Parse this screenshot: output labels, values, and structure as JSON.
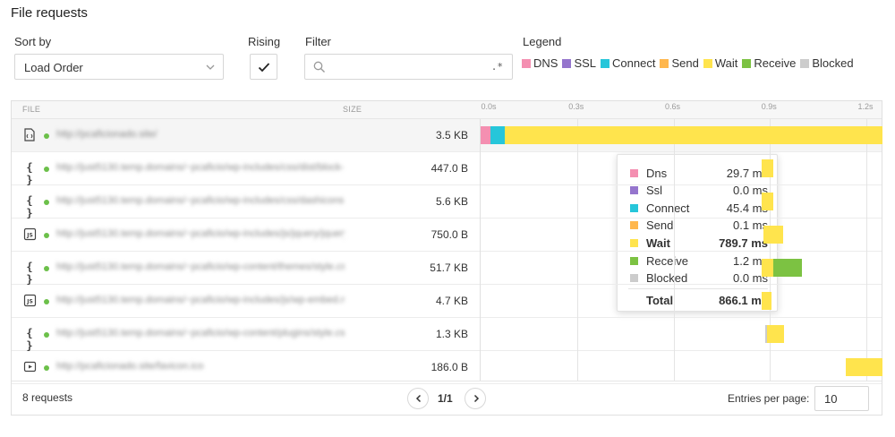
{
  "title": "File requests",
  "sort": {
    "label": "Sort by",
    "value": "Load Order"
  },
  "rising": {
    "label": "Rising",
    "checked": true
  },
  "filter": {
    "label": "Filter",
    "placeholder": "",
    "regex_symbol": ".*"
  },
  "legend": {
    "label": "Legend",
    "items": [
      {
        "name": "DNS",
        "color": "#f48fb1"
      },
      {
        "name": "SSL",
        "color": "#9575cd"
      },
      {
        "name": "Connect",
        "color": "#26c6da"
      },
      {
        "name": "Send",
        "color": "#ffb74d"
      },
      {
        "name": "Wait",
        "color": "#ffe44d"
      },
      {
        "name": "Receive",
        "color": "#7cc242"
      },
      {
        "name": "Blocked",
        "color": "#cccccc"
      }
    ]
  },
  "table": {
    "col_file": "FILE",
    "col_size": "SIZE",
    "ticks": [
      "0.0s",
      "0.3s",
      "0.6s",
      "0.9s",
      "1.2s"
    ],
    "tick_values": [
      0.0,
      0.3,
      0.6,
      0.9,
      1.2
    ],
    "axis_max_s": 1.25,
    "rows": [
      {
        "type": "html",
        "url": "http://pcaficionado.site/",
        "size": "3.5 KB",
        "status": "ok",
        "timing": [
          {
            "phase": "DNS",
            "start": 0.0,
            "end": 0.0297
          },
          {
            "phase": "Connect",
            "start": 0.0297,
            "end": 0.0751
          },
          {
            "phase": "Wait",
            "start": 0.0752,
            "end": 1.25
          }
        ]
      },
      {
        "type": "css",
        "url": "http://just5130.temp.domains/~pcaficio/wp-includes/css/dist/block-library/style.min.css",
        "size": "447.0 B",
        "status": "ok",
        "timing": [
          {
            "phase": "Wait",
            "start": 0.875,
            "end": 0.91
          }
        ]
      },
      {
        "type": "css",
        "url": "http://just5130.temp.domains/~pcaficio/wp-includes/css/dashicons.min.css",
        "size": "5.6 KB",
        "status": "ok",
        "timing": [
          {
            "phase": "Wait",
            "start": 0.875,
            "end": 0.91
          }
        ]
      },
      {
        "type": "js",
        "url": "http://just5130.temp.domains/~pcaficio/wp-includes/js/jquery/jquery.min.js",
        "size": "750.0 B",
        "status": "ok",
        "timing": [
          {
            "phase": "Wait",
            "start": 0.88,
            "end": 0.94
          }
        ]
      },
      {
        "type": "css",
        "url": "http://just5130.temp.domains/~pcaficio/wp-content/themes/style.css",
        "size": "51.7 KB",
        "status": "ok",
        "timing": [
          {
            "phase": "Wait",
            "start": 0.875,
            "end": 0.91
          },
          {
            "phase": "Receive",
            "start": 0.91,
            "end": 1.0
          }
        ]
      },
      {
        "type": "js",
        "url": "http://just5130.temp.domains/~pcaficio/wp-includes/js/wp-embed.min.js",
        "size": "4.7 KB",
        "status": "ok",
        "timing": [
          {
            "phase": "Wait",
            "start": 0.875,
            "end": 0.905
          }
        ]
      },
      {
        "type": "css",
        "url": "http://just5130.temp.domains/~pcaficio/wp-content/plugins/style.css",
        "size": "1.3 KB",
        "status": "ok",
        "timing": [
          {
            "phase": "Blocked",
            "start": 0.885,
            "end": 0.89
          },
          {
            "phase": "Wait",
            "start": 0.89,
            "end": 0.945
          }
        ]
      },
      {
        "type": "image",
        "url": "http://pcaficionado.site/favicon.ico",
        "size": "186.0 B",
        "status": "ok",
        "timing": [
          {
            "phase": "Wait",
            "start": 1.135,
            "end": 1.25
          }
        ]
      }
    ]
  },
  "tooltip": {
    "entries": [
      {
        "name": "Dns",
        "value": "29.7 ms",
        "color": "#f48fb1"
      },
      {
        "name": "Ssl",
        "value": "0.0 ms",
        "color": "#9575cd"
      },
      {
        "name": "Connect",
        "value": "45.4 ms",
        "color": "#26c6da"
      },
      {
        "name": "Send",
        "value": "0.1 ms",
        "color": "#ffb74d"
      },
      {
        "name": "Wait",
        "value": "789.7 ms",
        "color": "#ffe44d",
        "bold": true
      },
      {
        "name": "Receive",
        "value": "1.2 ms",
        "color": "#7cc242"
      },
      {
        "name": "Blocked",
        "value": "0.0 ms",
        "color": "#cccccc"
      }
    ],
    "total_label": "Total",
    "total_value": "866.1 ms"
  },
  "footer": {
    "count": "8 requests",
    "page": "1/1",
    "entries_label": "Entries per page:",
    "entries_value": "10"
  }
}
